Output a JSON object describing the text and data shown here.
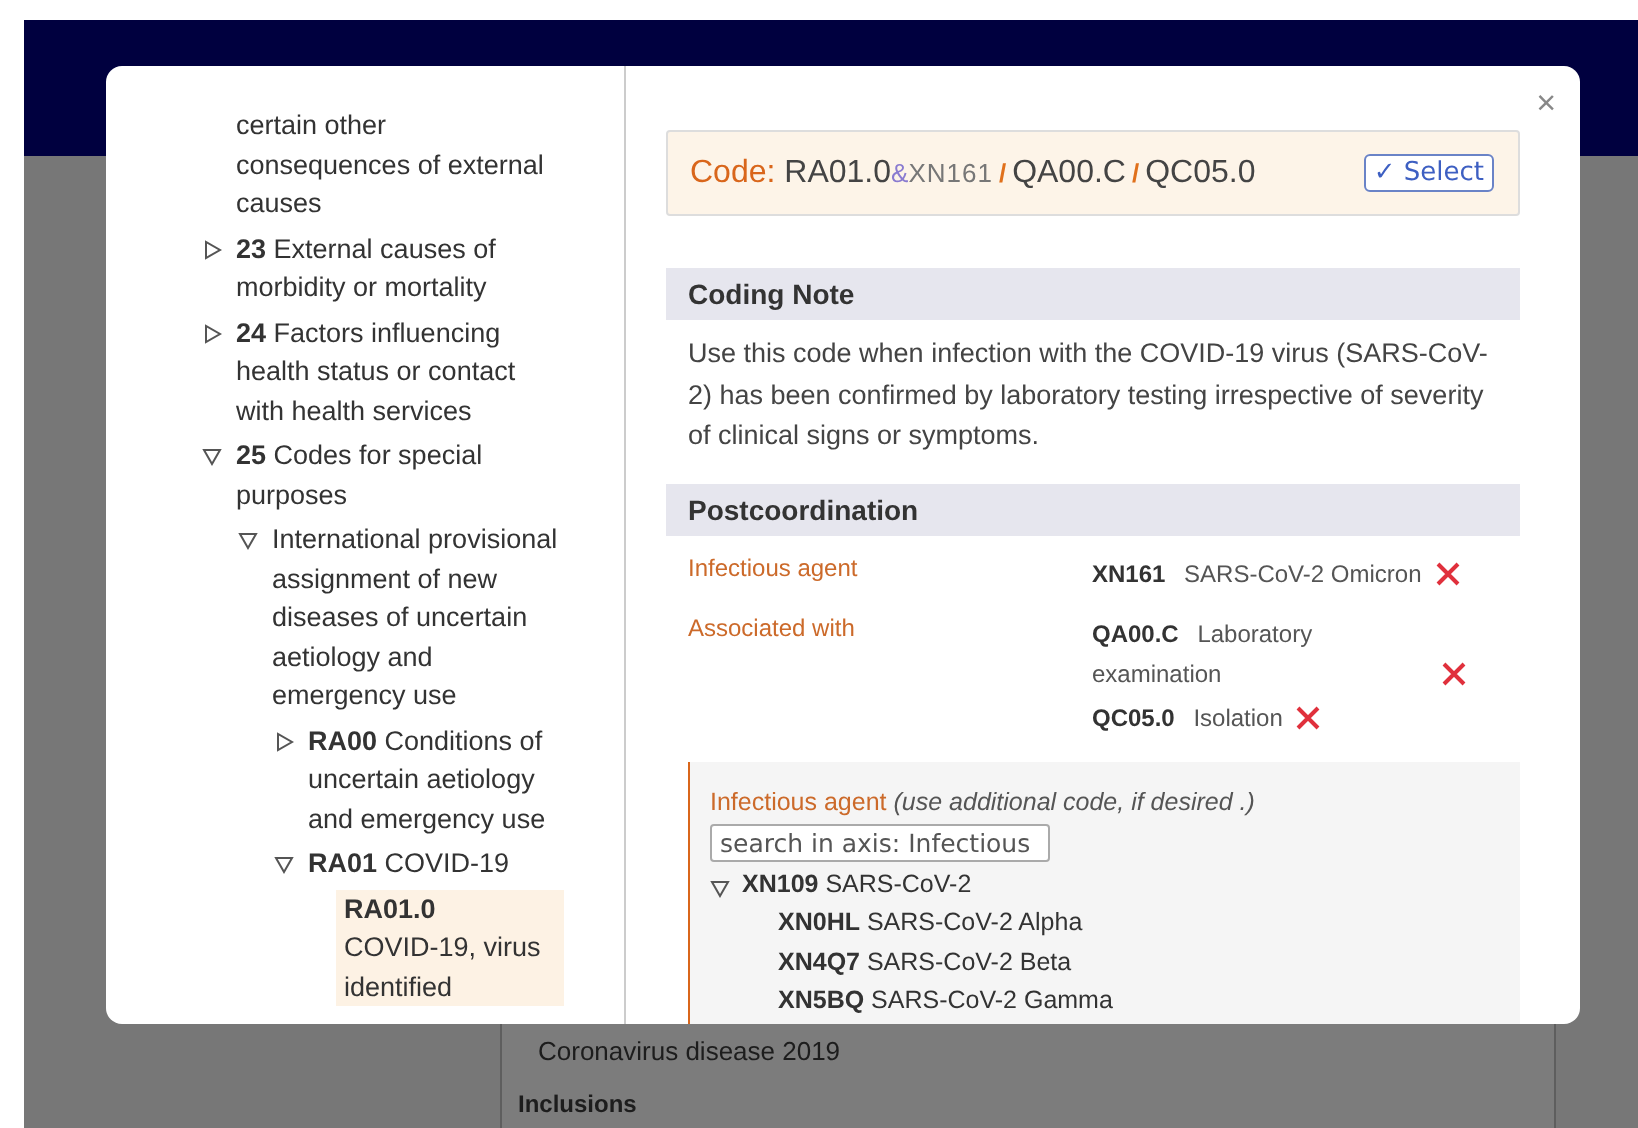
{
  "background": {
    "texts": [
      {
        "text": "Coronavirus disease 2019",
        "kind": "line"
      },
      {
        "text": "Inclusions",
        "kind": "heading"
      }
    ]
  },
  "dialog": {
    "close": "×",
    "tree": [
      {
        "kind": "fragment",
        "label": "certain other consequences of external causes",
        "selected": false
      },
      {
        "kind": "node",
        "code": "23",
        "label": "External causes of morbidity or mortality",
        "expanded": false,
        "selected": false
      },
      {
        "kind": "node",
        "code": "24",
        "label": "Factors influencing health status or contact with health services",
        "expanded": false,
        "selected": false
      },
      {
        "kind": "node",
        "code": "25",
        "label": "Codes for special purposes",
        "expanded": true,
        "selected": false,
        "children": [
          {
            "kind": "node",
            "label": "International provisional assignment of new diseases of uncertain aetiology and emergency use",
            "expanded": true,
            "selected": false,
            "children": [
              {
                "kind": "node",
                "code": "RA00",
                "label": "Conditions of uncertain aetiology and emergency use",
                "expanded": false,
                "selected": false
              },
              {
                "kind": "node",
                "code": "RA01",
                "label": "COVID-19",
                "expanded": true,
                "selected": false,
                "children": [
                  {
                    "kind": "leaf",
                    "code": "RA01.0",
                    "label": "COVID-19, virus identified",
                    "selected": true
                  }
                ]
              }
            ]
          }
        ]
      }
    ],
    "code_bar": {
      "label": "Code:",
      "parts": [
        {
          "kind": "stem",
          "text": "RA01.0"
        },
        {
          "kind": "amp",
          "text": "&"
        },
        {
          "kind": "extension",
          "text": "XN161"
        },
        {
          "kind": "slash",
          "text": "/"
        },
        {
          "kind": "stem",
          "text": "QA00.C"
        },
        {
          "kind": "slash",
          "text": "/"
        },
        {
          "kind": "stem",
          "text": "QC05.0"
        }
      ],
      "select_button": {
        "check": "✓",
        "label": "Select"
      }
    },
    "coding_note": {
      "title": "Coding Note",
      "text": "Use this code when infection with the COVID-19 virus (SARS-CoV-2) has been confirmed by laboratory testing irrespective of severity of clinical signs or symptoms."
    },
    "postcoordination": {
      "title": "Postcoordination",
      "rows": [
        {
          "axis": "Infectious agent",
          "values": [
            {
              "code": "XN161",
              "label": "SARS-CoV-2 Omicron"
            }
          ]
        },
        {
          "axis": "Associated with",
          "values": [
            {
              "code": "QA00.C",
              "label": "Laboratory examination"
            },
            {
              "code": "QC05.0",
              "label": "Isolation"
            }
          ]
        }
      ]
    },
    "axis_panel": {
      "title": "Infectious agent",
      "hint": "(use additional code, if desired .)",
      "search": {
        "placeholder": "search in axis: Infectious"
      },
      "tree": [
        {
          "code": "XN109",
          "label": "SARS-CoV-2",
          "expanded": true,
          "children": [
            {
              "code": "XN0HL",
              "label": "SARS-CoV-2 Alpha"
            },
            {
              "code": "XN4Q7",
              "label": "SARS-CoV-2 Beta"
            },
            {
              "code": "XN5BQ",
              "label": "SARS-CoV-2 Gamma"
            }
          ]
        }
      ]
    }
  }
}
